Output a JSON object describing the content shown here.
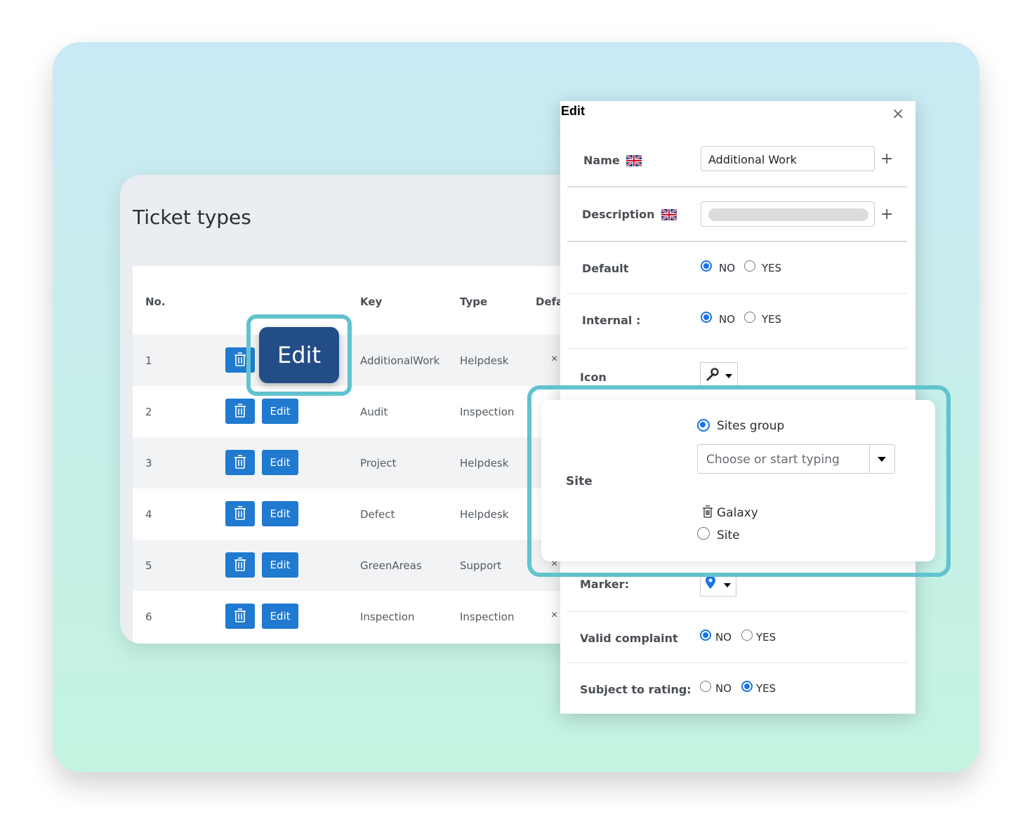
{
  "ticket_list": {
    "title": "Ticket types",
    "columns": [
      "No.",
      "Key",
      "Type",
      "Defa"
    ],
    "rows": [
      {
        "no": "1",
        "key": "AdditionalWork",
        "type": "Helpdesk",
        "edit": "Edit",
        "default_mark": "×"
      },
      {
        "no": "2",
        "key": "Audit",
        "type": "Inspection",
        "edit": "Edit",
        "default_mark": ""
      },
      {
        "no": "3",
        "key": "Project",
        "type": "Helpdesk",
        "edit": "Edit",
        "default_mark": ""
      },
      {
        "no": "4",
        "key": "Defect",
        "type": "Helpdesk",
        "edit": "Edit",
        "default_mark": ""
      },
      {
        "no": "5",
        "key": "GreenAreas",
        "type": "Support",
        "edit": "Edit",
        "default_mark": "×"
      },
      {
        "no": "6",
        "key": "Inspection",
        "type": "Inspection",
        "edit": "Edit",
        "default_mark": "×"
      }
    ],
    "highlighted_edit": "Edit"
  },
  "modal": {
    "title": "Edit",
    "close": "×",
    "plus": "+",
    "fields": {
      "name_label": "Name",
      "name_value": "Additional Work",
      "description_label": "Description",
      "default_label": "Default",
      "internal_label": "Internal :",
      "icon_label": "Icon",
      "marker_label": "Marker:",
      "valid_complaint_label": "Valid complaint",
      "subject_to_rating_label": "Subject to rating:"
    },
    "options": {
      "no": "NO",
      "yes": "YES"
    },
    "selected": {
      "default": "NO",
      "internal": "NO",
      "valid_complaint": "NO",
      "subject_to_rating": "YES"
    },
    "site": {
      "label": "Site",
      "option_group": "Sites group",
      "select_placeholder": "Choose or start typing",
      "selected_item": "Galaxy",
      "option_site": "Site",
      "selected_option": "Sites group"
    }
  },
  "colors": {
    "primary_button": "#1f7ad0",
    "highlight_border": "#61c3cf",
    "big_edit_button": "#234d86",
    "radio_on": "#1a73e8"
  }
}
